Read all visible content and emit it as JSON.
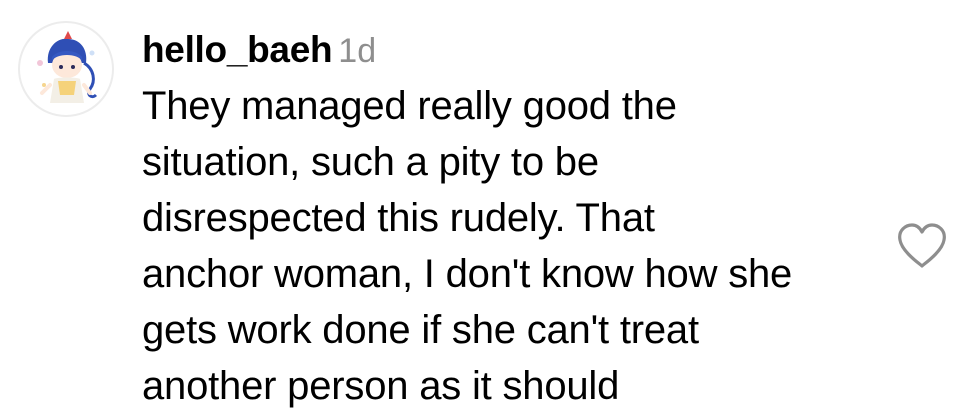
{
  "comment": {
    "username": "hello_baeh",
    "timestamp": "1d",
    "lines": [
      "They managed really good the",
      "situation, such a pity to be",
      "disrespected this rudely. That",
      "anchor woman, I don't know how she",
      "gets work done if she can't treat",
      "another person as it should"
    ],
    "like_icon": "heart-outline-icon"
  },
  "colors": {
    "text": "#000000",
    "timestamp": "#8e8e8e",
    "icon": "#8e8e8e"
  }
}
